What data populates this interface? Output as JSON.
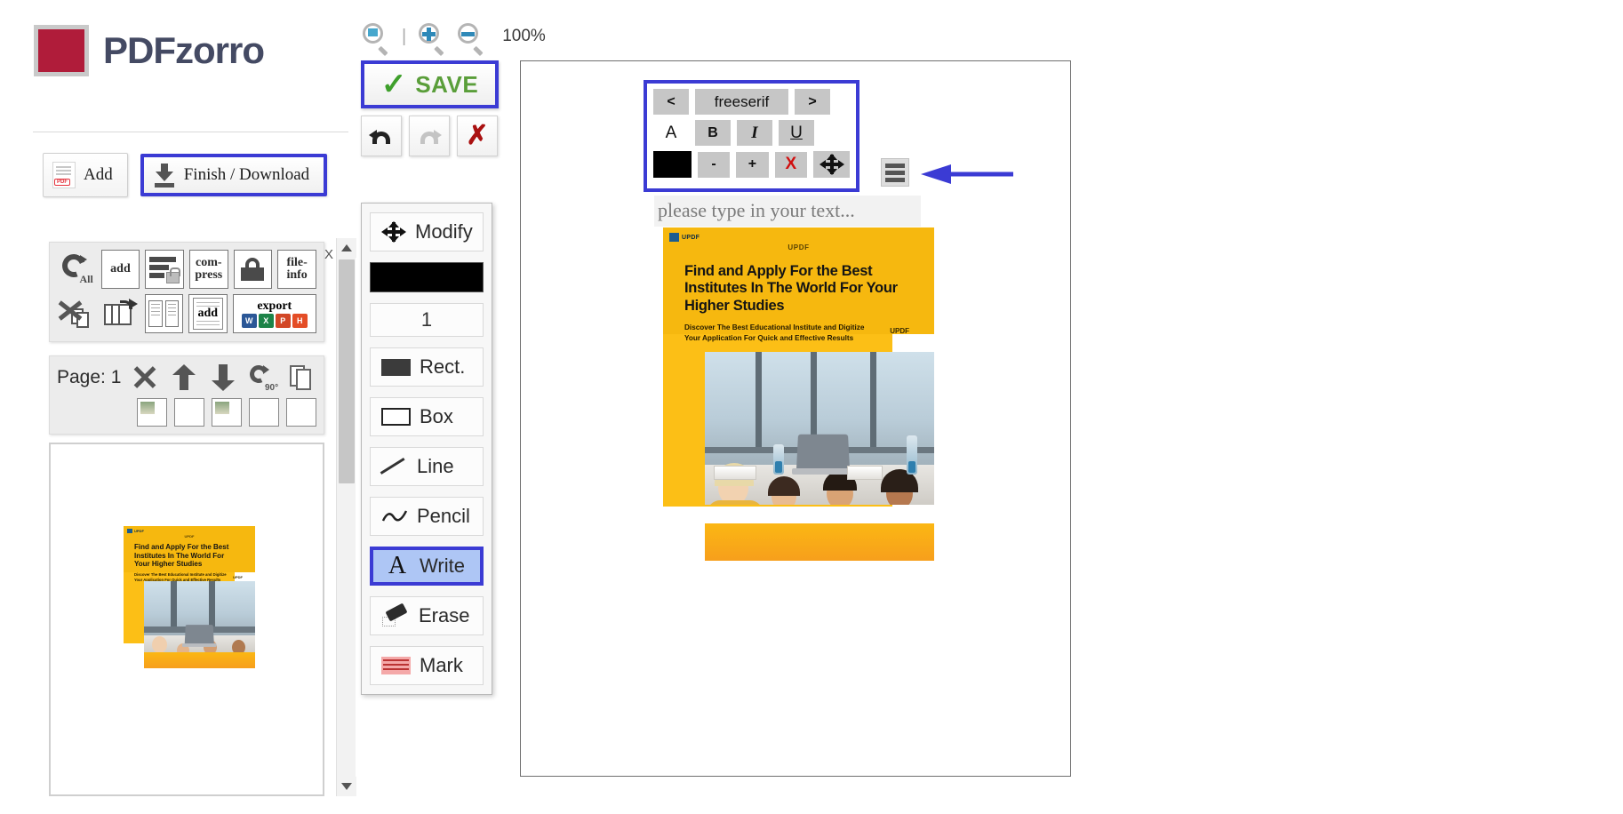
{
  "brand": {
    "name_bold": "PDF",
    "name_rest": "zorro",
    "logo_icon": "red-square-logo"
  },
  "top_buttons": {
    "add": {
      "label": "Add",
      "icon": "pdf-document-icon"
    },
    "finish": {
      "label": "Finish / Download",
      "icon": "download-arrow-icon",
      "highlighted": true
    }
  },
  "tool_grid": {
    "close_label": "X",
    "row1": [
      {
        "name": "rotate-all",
        "label": "All",
        "icon": "rotate-all-icon"
      },
      {
        "name": "add-pdf",
        "label": "add",
        "icon": "add-page-icon"
      },
      {
        "name": "merge-protect",
        "label": "",
        "icon": "merge-lock-icon"
      },
      {
        "name": "compress",
        "label": "com-press",
        "icon": "compress-icon"
      },
      {
        "name": "protect",
        "label": "",
        "icon": "lock-icon"
      },
      {
        "name": "file-info",
        "label": "file-info",
        "icon": "file-info-icon"
      }
    ],
    "row2": [
      {
        "name": "delete-pages",
        "label": "",
        "icon": "delete-pages-icon"
      },
      {
        "name": "copy-pages",
        "label": "",
        "icon": "copy-pages-icon"
      },
      {
        "name": "split-pages",
        "label": "",
        "icon": "split-pages-icon"
      },
      {
        "name": "add-text-page",
        "label": "add",
        "icon": "add-blank-page-icon"
      },
      {
        "name": "export",
        "label": "export",
        "icon": "export-office-icon",
        "formats": [
          "W",
          "X",
          "P",
          "H"
        ]
      }
    ]
  },
  "page_panel": {
    "page_label": "Page: 1",
    "actions_row1": [
      {
        "name": "delete-page",
        "icon": "x-icon"
      },
      {
        "name": "move-page-up",
        "icon": "arrow-up-icon"
      },
      {
        "name": "move-page-down",
        "icon": "arrow-down-icon"
      },
      {
        "name": "rotate-page",
        "icon": "rotate-90-icon",
        "label": "90°"
      },
      {
        "name": "duplicate-page",
        "icon": "duplicate-pages-icon"
      }
    ],
    "actions_row2": [
      {
        "name": "rotate-image-page",
        "icon": "page-rotate-icon"
      },
      {
        "name": "flip-page",
        "icon": "page-flip-icon"
      },
      {
        "name": "download-page",
        "icon": "page-download-icon"
      },
      {
        "name": "resize-page",
        "icon": "resize-diagonal-icon"
      },
      {
        "name": "redo-page",
        "icon": "page-redo-icon"
      }
    ]
  },
  "zoom_controls": {
    "fit": {
      "name": "zoom-fit",
      "icon": "magnifier-fit-icon"
    },
    "separator": "|",
    "zoom_in": {
      "name": "zoom-in",
      "icon": "magnifier-plus-icon"
    },
    "zoom_out": {
      "name": "zoom-out",
      "icon": "magnifier-minus-icon"
    },
    "level": "100%"
  },
  "save_button": {
    "label": "SAVE",
    "icon": "green-check-icon",
    "highlighted": true
  },
  "history_buttons": {
    "undo": {
      "name": "undo",
      "icon": "undo-arrow-icon",
      "enabled": true
    },
    "redo": {
      "name": "redo",
      "icon": "redo-arrow-icon",
      "enabled": false
    },
    "clear": {
      "name": "clear-all",
      "icon": "red-x-icon"
    }
  },
  "tool_stack": {
    "modify": {
      "label": "Modify",
      "icon": "move-arrows-icon"
    },
    "color_swatch": {
      "name": "color-swatch",
      "color": "#000000"
    },
    "stroke_width": "1",
    "tools": [
      {
        "label": "Rect.",
        "icon": "filled-rectangle-icon",
        "selected": false
      },
      {
        "label": "Box",
        "icon": "outline-box-icon",
        "selected": false
      },
      {
        "label": "Line",
        "icon": "diagonal-line-icon",
        "selected": false
      },
      {
        "label": "Pencil",
        "icon": "pencil-squiggle-icon",
        "selected": false
      },
      {
        "label": "Write",
        "icon": "letter-a-icon",
        "selected": true
      },
      {
        "label": "Erase",
        "icon": "eraser-icon",
        "selected": false
      },
      {
        "label": "Mark",
        "icon": "highlighter-marker-icon",
        "selected": false
      }
    ]
  },
  "font_toolbar": {
    "prev": "<",
    "font_name": "freeserif",
    "next": ">",
    "plain": "A",
    "bold": "B",
    "italic": "I",
    "underline": "U",
    "color": "#000000",
    "decrease": "-",
    "increase": "+",
    "remove": "X",
    "move": "move-arrows-icon",
    "highlighted": true
  },
  "menu_button": {
    "name": "hamburger-menu",
    "icon": "hamburger-lines-icon"
  },
  "annotation_arrow": {
    "name": "blue-pointer-arrow",
    "color": "#3b3bd4",
    "points_to": "hamburger-menu"
  },
  "text_input": {
    "placeholder": "please type in your text...",
    "value": ""
  },
  "pdf_page": {
    "brand_top": "UPDF",
    "brand_center": "UPDF",
    "brand_right": "UPDF",
    "title": "Find and Apply For the Best Institutes In The World For Your Higher Studies",
    "subtitle": "Discover The Best Educational Institute and Digitize Your Application For Quick and Effective Results",
    "photo_alt": "students-studying-with-laptop-photo",
    "accent_color": "#f6b80f"
  },
  "thumbnail_panel": {
    "scroll_up": "scroll-up-arrow",
    "scroll_down": "scroll-down-arrow"
  }
}
